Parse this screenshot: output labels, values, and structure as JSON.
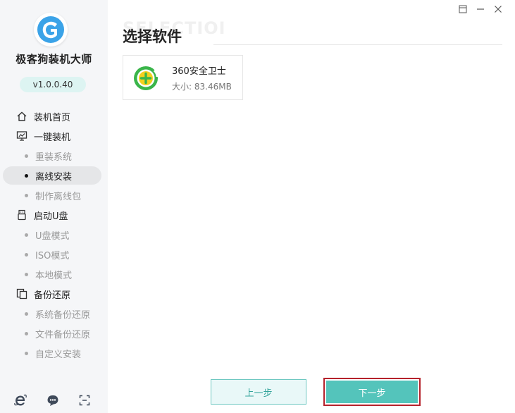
{
  "window": {
    "controls": [
      "restore-icon",
      "minimize-icon",
      "close-icon"
    ]
  },
  "sidebar": {
    "app_name": "极客狗装机大师",
    "version": "v1.0.0.40",
    "logo_icon": "dog-logo-icon",
    "menu": [
      {
        "label": "装机首页",
        "icon": "home-icon"
      },
      {
        "label": "一键装机",
        "icon": "monitor-icon"
      },
      {
        "label": "重装系统"
      },
      {
        "label": "离线安装",
        "active": true
      },
      {
        "label": "制作离线包"
      },
      {
        "label": "启动U盘",
        "icon": "usb-icon"
      },
      {
        "label": "U盘模式"
      },
      {
        "label": "ISO模式"
      },
      {
        "label": "本地模式"
      },
      {
        "label": "备份还原",
        "icon": "backup-icon"
      },
      {
        "label": "系统备份还原"
      },
      {
        "label": "文件备份还原"
      },
      {
        "label": "自定义安装"
      }
    ],
    "bottom_icons": [
      "ie-browser-icon",
      "chat-icon",
      "screenshot-icon"
    ]
  },
  "main": {
    "watermark": "SELECTIOI",
    "title": "选择软件",
    "software": [
      {
        "name": "360安全卫士",
        "size": "大小: 83.46MB",
        "icon": "360-security-icon"
      }
    ],
    "prev_label": "上一步",
    "next_label": "下一步"
  },
  "colors": {
    "accent": "#54c4bb",
    "highlight_border": "#b5222c",
    "sidebar_bg": "#f5f6f8"
  }
}
